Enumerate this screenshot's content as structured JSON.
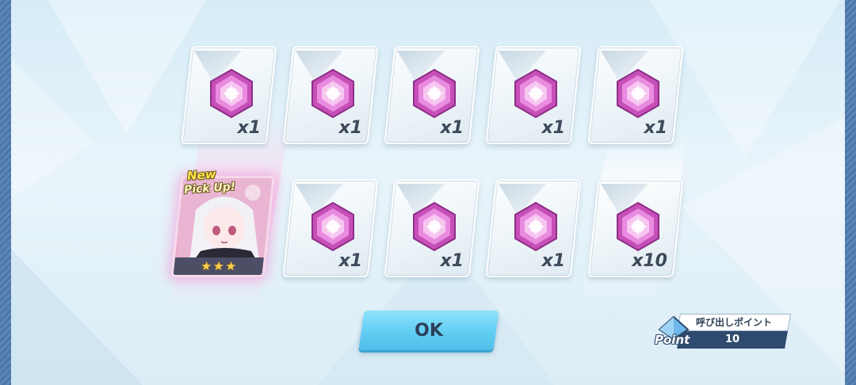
{
  "results": [
    {
      "kind": "item",
      "quantity": "x1",
      "icon": "pink-hexagon-gem-icon"
    },
    {
      "kind": "item",
      "quantity": "x1",
      "icon": "pink-hexagon-gem-icon"
    },
    {
      "kind": "item",
      "quantity": "x1",
      "icon": "pink-hexagon-gem-icon"
    },
    {
      "kind": "item",
      "quantity": "x1",
      "icon": "pink-hexagon-gem-icon"
    },
    {
      "kind": "item",
      "quantity": "x1",
      "icon": "pink-hexagon-gem-icon"
    },
    {
      "kind": "character",
      "badge_new": "New",
      "badge_pickup": "Pick Up!",
      "stars": 3,
      "star_glyph": "★"
    },
    {
      "kind": "item",
      "quantity": "x1",
      "icon": "pink-hexagon-gem-icon"
    },
    {
      "kind": "item",
      "quantity": "x1",
      "icon": "pink-hexagon-gem-icon"
    },
    {
      "kind": "item",
      "quantity": "x1",
      "icon": "pink-hexagon-gem-icon"
    },
    {
      "kind": "item",
      "quantity": "x10",
      "icon": "pink-hexagon-gem-icon"
    }
  ],
  "ok_button": {
    "label": "OK"
  },
  "points": {
    "title": "呼び出しポイント",
    "label": "Point",
    "value": "10"
  },
  "colors": {
    "accent_button": "#61cdf3",
    "gem_pink": "#e070d8",
    "star_gold": "#ffd54a",
    "point_navy": "#2e4a6e"
  }
}
